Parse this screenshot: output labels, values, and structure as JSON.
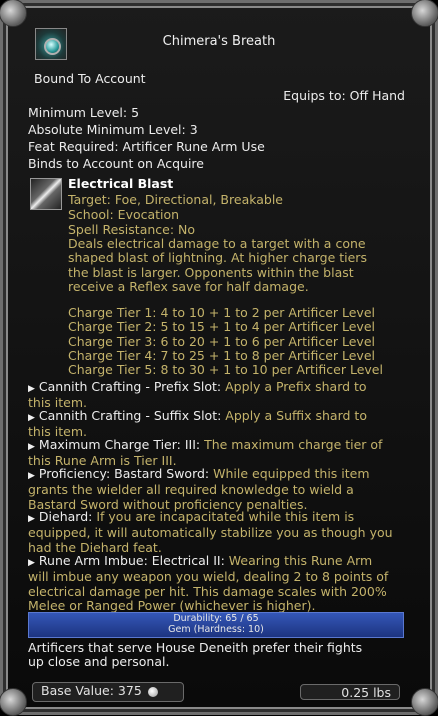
{
  "item": {
    "name": "Chimera's Breath",
    "bound": "Bound To Account",
    "equips": "Equips to: Off Hand",
    "min_level": "Minimum Level: 5",
    "abs_min_level": "Absolute Minimum Level: 3",
    "feat": "Feat Required: Artificer Rune Arm Use",
    "binds": "Binds to Account on Acquire"
  },
  "spell": {
    "name": "Electrical Blast",
    "target": "Target: Foe, Directional, Breakable",
    "school": "School: Evocation",
    "resistance": "Spell Resistance: No",
    "desc": [
      "Deals electrical damage to a target with a cone",
      "shaped blast of lightning. At higher charge tiers",
      "the blast is larger. Opponents within the blast",
      "receive a Reflex save for half damage."
    ],
    "tiers": [
      "Charge Tier 1: 4 to 10 + 1 to 2 per Artificer Level",
      "Charge Tier 2: 5 to 15 + 1 to 4 per Artificer Level",
      "Charge Tier 3: 6 to 20 + 1 to 6 per Artificer Level",
      "Charge Tier 4: 7 to 25 + 1 to 8 per Artificer Level",
      "Charge Tier 5: 8 to 30 + 1 to 10 per Artificer Level"
    ]
  },
  "effects": [
    {
      "label": "Cannith Crafting - Prefix Slot:",
      "lines": [
        " Apply a Prefix shard to",
        "this item."
      ]
    },
    {
      "label": "Cannith Crafting - Suffix Slot:",
      "lines": [
        " Apply a Suffix shard to",
        "this item."
      ]
    },
    {
      "label": "Maximum Charge Tier: III:",
      "lines": [
        " The maximum charge tier of",
        "this Rune Arm is Tier III."
      ]
    },
    {
      "label": "Proficiency: Bastard Sword:",
      "lines": [
        " While equipped this item",
        "grants the wielder all required knowledge to wield a",
        "Bastard Sword without proficiency penalties."
      ]
    },
    {
      "label": "Diehard:",
      "lines": [
        " If you are incapacitated while this item is",
        "equipped, it will automatically stabilize you as though you",
        "had the Diehard feat."
      ]
    },
    {
      "label": "Rune Arm Imbue: Electrical II:",
      "lines": [
        " Wearing this Rune Arm",
        "will imbue any weapon you wield, dealing 2 to 8 points of",
        "electrical damage per hit. This damage scales with 200%",
        "Melee or Ranged Power (whichever is higher)."
      ]
    }
  ],
  "durability": {
    "text": "Durability: 65 / 65",
    "fraction": 1.0,
    "material": "Gem (Hardness: 10)"
  },
  "flavor": [
    "Artificers that serve House Deneith prefer their fights",
    "up close and personal."
  ],
  "footer": {
    "value": "Base Value: 375",
    "weight": "0.25 lbs"
  }
}
